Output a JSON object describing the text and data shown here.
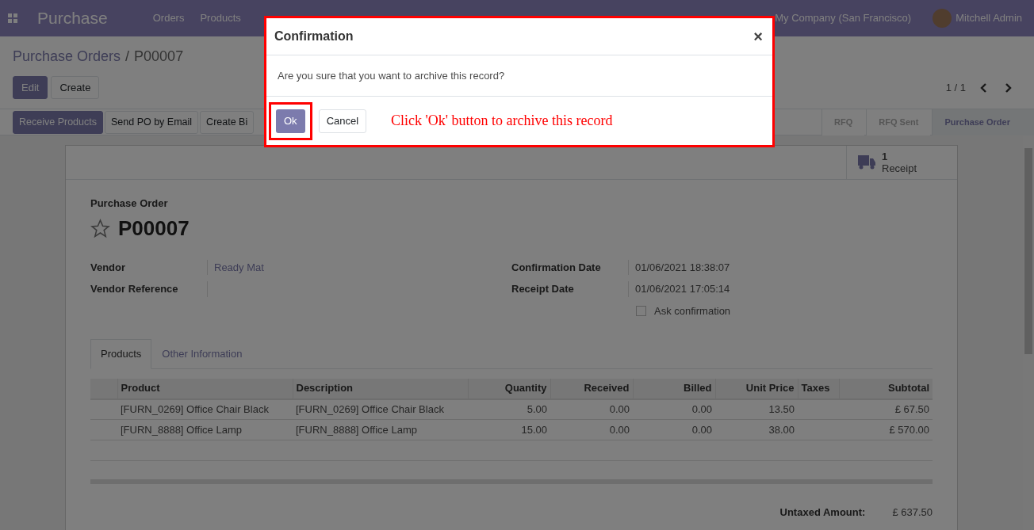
{
  "navbar": {
    "app": "Purchase",
    "menu": [
      "Orders",
      "Products"
    ],
    "company": "My Company (San Francisco)",
    "user": "Mitchell Admin"
  },
  "breadcrumb": {
    "parent": "Purchase Orders",
    "separator": "/",
    "current": "P00007"
  },
  "control_buttons": [
    {
      "label": "Edit",
      "kind": "primary"
    },
    {
      "label": "Create",
      "kind": "secondary"
    }
  ],
  "pager": "1 / 1",
  "header_buttons": [
    {
      "label": "Receive Products",
      "kind": "primary"
    },
    {
      "label": "Send PO by Email",
      "kind": "secondary"
    },
    {
      "label": "Create Bi",
      "kind": "secondary"
    }
  ],
  "stages": [
    {
      "label": "RFQ",
      "selected": false
    },
    {
      "label": "RFQ Sent",
      "selected": false
    },
    {
      "label": "Purchase Order",
      "selected": true
    }
  ],
  "stat_button": {
    "count": "1",
    "label": "Receipt"
  },
  "form": {
    "subtitle": "Purchase Order",
    "name": "P00007",
    "starred": false,
    "left_fields": [
      {
        "label": "Vendor",
        "value": "Ready Mat",
        "kind": "link"
      },
      {
        "label": "Vendor Reference",
        "kind": "text"
      }
    ],
    "right_fields": [
      {
        "label": "Confirmation Date",
        "value": "01/06/2021 18:38:07"
      },
      {
        "label": "Receipt Date",
        "value": "01/06/2021 17:05:14"
      }
    ],
    "ask_confirmation": {
      "label": "Ask confirmation",
      "checked": false
    }
  },
  "tabs": [
    {
      "label": "Products",
      "selected": true
    },
    {
      "label": "Other Information",
      "selected": false
    }
  ],
  "table": {
    "columns": [
      "Product",
      "Description",
      "Quantity",
      "Received",
      "Billed",
      "Unit Price",
      "Taxes",
      "Subtotal"
    ],
    "rows": [
      [
        "[FURN_0269] Office Chair Black",
        "[FURN_0269] Office Chair Black",
        "5.00",
        "0.00",
        "0.00",
        "13.50",
        "",
        "£ 67.50"
      ],
      [
        "[FURN_8888] Office Lamp",
        "[FURN_8888] Office Lamp",
        "15.00",
        "0.00",
        "0.00",
        "38.00",
        "",
        "£ 570.00"
      ]
    ]
  },
  "totals": [
    {
      "label": "Untaxed Amount:",
      "value": "£ 637.50"
    }
  ],
  "dialog": {
    "title": "Confirmation",
    "close": "×",
    "message": "Are you sure that you want to archive this record?",
    "ok": "Ok",
    "cancel": "Cancel",
    "annotation": "Click 'Ok' button to archive this record"
  }
}
